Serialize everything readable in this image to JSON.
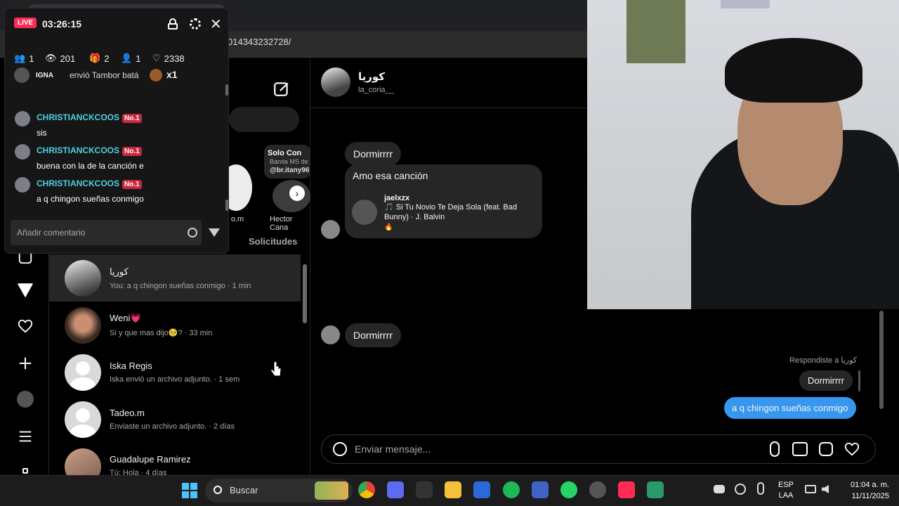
{
  "browser": {
    "url_partial": "014343232728/"
  },
  "live": {
    "badge": "LIVE",
    "timer": "03:26:15",
    "stats": {
      "followers": "1",
      "viewers": "201",
      "gifts": "2",
      "joins": "1",
      "likes": "2338"
    },
    "gift_event": {
      "user": "IGNA",
      "text": "envió Tambor batá",
      "count": "x1"
    },
    "comments": [
      {
        "user": "CHRISTIANCKCOOS",
        "badge": "No.1",
        "text": "sis"
      },
      {
        "user": "CHRISTIANCKCOOS",
        "badge": "No.1",
        "text": "buena con la de la canción e"
      },
      {
        "user": "CHRISTIANCKCOOS",
        "badge": "No.1",
        "text": "a q chingon sueñas conmigo"
      }
    ],
    "comment_placeholder": "Añadir comentario"
  },
  "notes": {
    "note1_title": "Solo Con",
    "note1_sub": "Banda MS de",
    "note1_handle": "@br.itany96",
    "label_a": "o.m",
    "label_b": "Hector Cana"
  },
  "list": {
    "requests_label": "Solicitudes",
    "conversations": [
      {
        "name": "كوريا",
        "preview": "You: a q chingon sueñas conmigo · 1 min"
      },
      {
        "name": "Weni💗",
        "preview": "Si y que mas dijo🥺? · 33 min"
      },
      {
        "name": "Iska Regis",
        "preview": "Iska envió un archivo adjunto. · 1 sem"
      },
      {
        "name": "Tadeo.m",
        "preview": "Enviaste un archivo adjunto. · 2 días"
      },
      {
        "name": "Guadalupe Ramirez",
        "preview": "Tú: Hola · 4 días"
      }
    ]
  },
  "chat": {
    "contact_name": "كوريا",
    "contact_handle": "la_coria__",
    "messages": {
      "m1": "Dormirrrr",
      "m2": "Amo esa canción",
      "share_user": "jaelxzx",
      "share_song": "🎵 Si Tu Novio Te Deja Sola (feat. Bad Bunny) · J. Balvin",
      "share_emoji": "🔥",
      "m3": "Dormirrrr",
      "reply_label": "Respondiste a كوريا",
      "reply_quote": "Dormirrrr",
      "sent": "a q chingon sueñas conmigo"
    },
    "composer_placeholder": "Enviar mensaje..."
  },
  "taskbar": {
    "search_label": "Buscar",
    "lang_top": "ESP",
    "lang_bottom": "LAA",
    "time": "01:04 a. m.",
    "date": "11/11/2025"
  },
  "colors": {
    "accent_blue": "#3797f0",
    "live_red": "#fe2c55",
    "username_cyan": "#4fd1e0"
  }
}
